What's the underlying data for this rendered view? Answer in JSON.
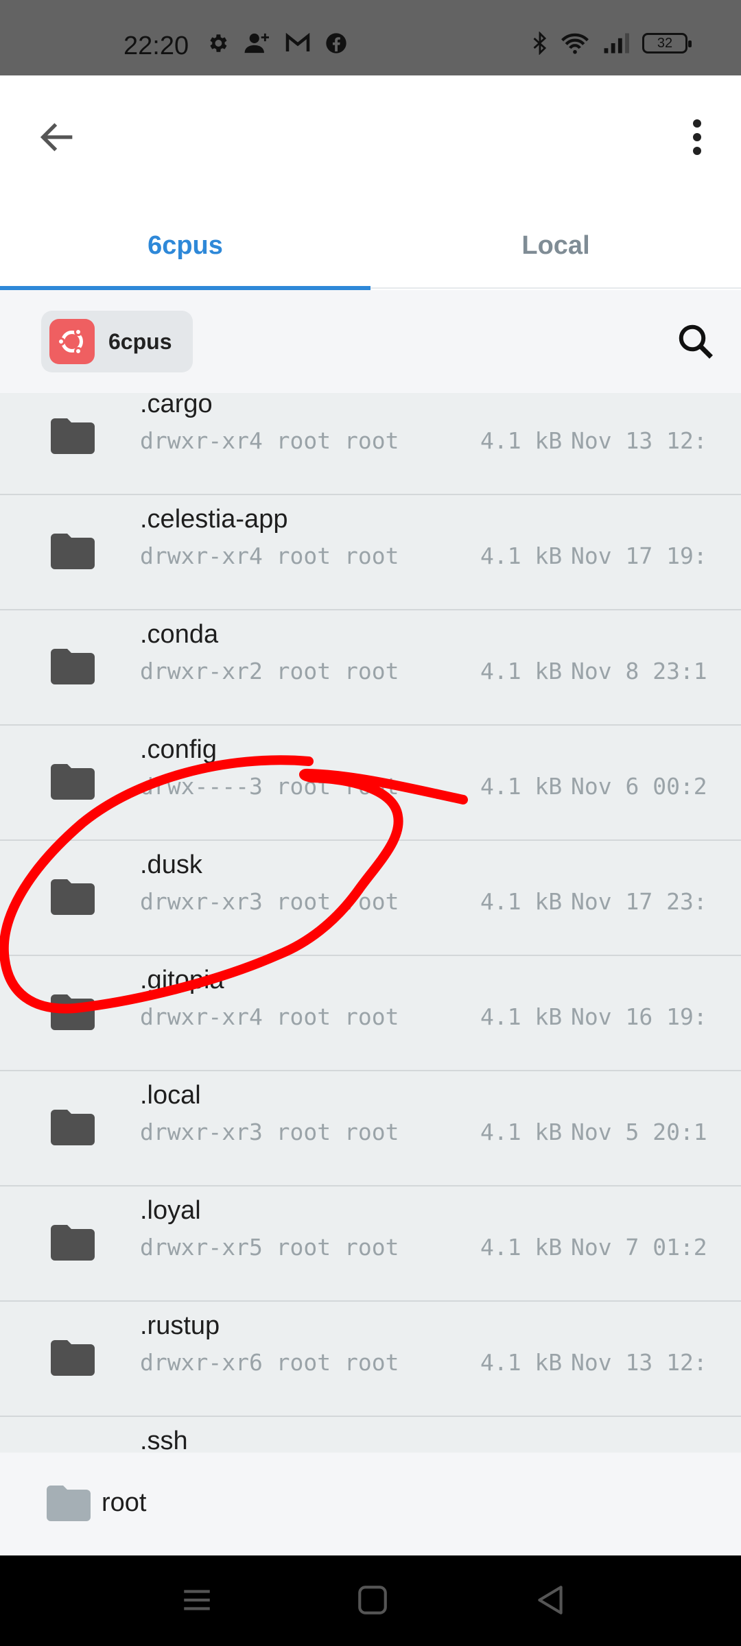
{
  "status_bar": {
    "time": "22:20",
    "battery": "32",
    "icons_left": [
      "gear-icon",
      "person-add-icon",
      "gmail-icon",
      "facebook-icon"
    ],
    "icons_right": [
      "bluetooth-icon",
      "wifi-icon",
      "signal-icon",
      "battery-icon"
    ]
  },
  "app_bar": {
    "back": "arrow-back-icon",
    "menu": "more-vert-icon"
  },
  "tabs": [
    {
      "label": "6cpus",
      "active": true
    },
    {
      "label": "Local",
      "active": false
    }
  ],
  "server": {
    "name": "6cpus",
    "logo": "ubuntu-logo",
    "logo_color": "#ef5f61"
  },
  "files": [
    {
      "name": ".cargo",
      "perms": "drwxr-xr4 root root",
      "size": "4.1 kB",
      "date": "Nov 13 12:"
    },
    {
      "name": ".celestia-app",
      "perms": "drwxr-xr4 root root",
      "size": "4.1 kB",
      "date": "Nov 17 19:"
    },
    {
      "name": ".conda",
      "perms": "drwxr-xr2 root root",
      "size": "4.1 kB",
      "date": "Nov 8 23:1"
    },
    {
      "name": ".config",
      "perms": "drwx----3 root root",
      "size": "4.1 kB",
      "date": "Nov 6 00:2"
    },
    {
      "name": ".dusk",
      "perms": "drwxr-xr3 root root",
      "size": "4.1 kB",
      "date": "Nov 17 23:"
    },
    {
      "name": ".gitopia",
      "perms": "drwxr-xr4 root root",
      "size": "4.1 kB",
      "date": "Nov 16 19:"
    },
    {
      "name": ".local",
      "perms": "drwxr-xr3 root root",
      "size": "4.1 kB",
      "date": "Nov 5 20:1"
    },
    {
      "name": ".loyal",
      "perms": "drwxr-xr5 root root",
      "size": "4.1 kB",
      "date": "Nov 7 01:2"
    },
    {
      "name": ".rustup",
      "perms": "drwxr-xr6 root root",
      "size": "4.1 kB",
      "date": "Nov 13 12:"
    },
    {
      "name": ".ssh",
      "perms": "",
      "size": "",
      "date": ""
    }
  ],
  "path": {
    "label": "root"
  },
  "colors": {
    "accent": "#2e88d8",
    "annotation": "#ff0000",
    "list_bg": "#eceff0"
  },
  "nav": [
    "menu-icon",
    "home-icon",
    "back-triangle-icon"
  ]
}
